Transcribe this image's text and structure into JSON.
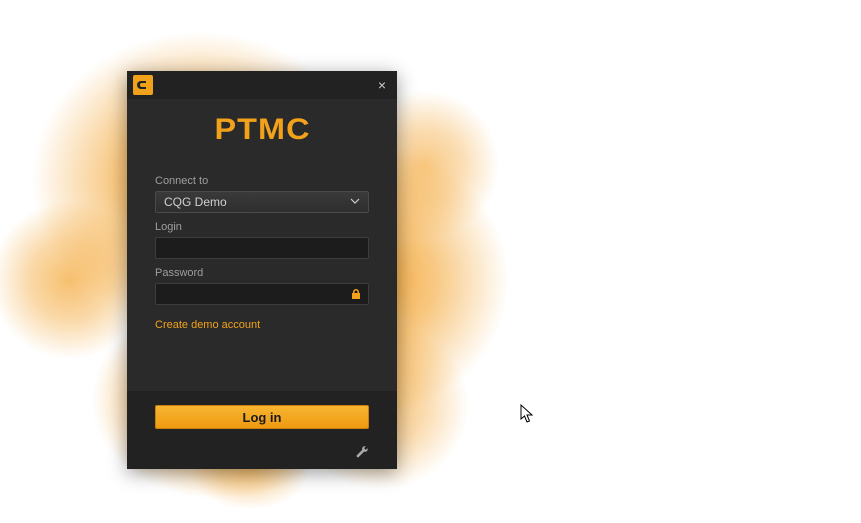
{
  "brand": "PTMC",
  "close_label": "×",
  "form": {
    "connect_label": "Connect to",
    "connect_value": "CQG Demo",
    "login_label": "Login",
    "login_value": "",
    "password_label": "Password",
    "password_value": "",
    "create_account_link": "Create demo account"
  },
  "login_button": "Log in",
  "colors": {
    "accent": "#f2a21a",
    "panel_bg": "#2a2a2a",
    "footer_bg": "#222222"
  }
}
